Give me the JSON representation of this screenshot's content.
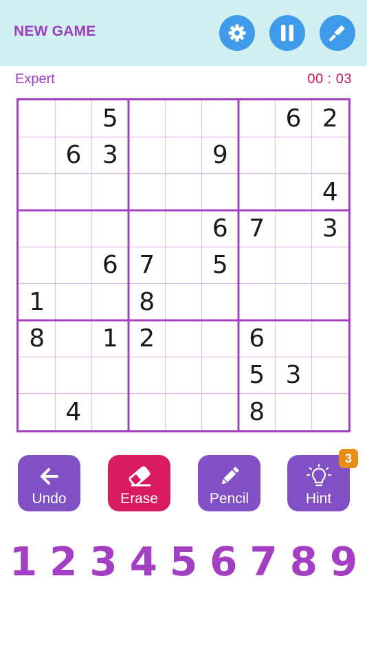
{
  "header": {
    "new_game_label": "NEW GAME",
    "buttons": [
      "gear-icon",
      "pause-icon",
      "paint-brush-icon"
    ]
  },
  "status": {
    "difficulty": "Expert",
    "timer": "00 : 03"
  },
  "board": {
    "rows": [
      [
        "",
        "",
        "5",
        "",
        "",
        "",
        "",
        "6",
        "2"
      ],
      [
        "",
        "6",
        "3",
        "",
        "",
        "9",
        "",
        "",
        ""
      ],
      [
        "",
        "",
        "",
        "",
        "",
        "",
        "",
        "",
        "4"
      ],
      [
        "",
        "",
        "",
        "",
        "",
        "6",
        "7",
        "",
        "3"
      ],
      [
        "",
        "",
        "6",
        "7",
        "",
        "5",
        "",
        "",
        ""
      ],
      [
        "1",
        "",
        "",
        "8",
        "",
        "",
        "",
        "",
        ""
      ],
      [
        "8",
        "",
        "1",
        "2",
        "",
        "",
        "6",
        "",
        ""
      ],
      [
        "",
        "",
        "",
        "",
        "",
        "",
        "5",
        "3",
        ""
      ],
      [
        "",
        "4",
        "",
        "",
        "",
        "",
        "8",
        "",
        ""
      ]
    ]
  },
  "actions": {
    "undo": "Undo",
    "erase": "Erase",
    "pencil": "Pencil",
    "hint": "Hint",
    "hint_count": "3"
  },
  "numpad": [
    "1",
    "2",
    "3",
    "4",
    "5",
    "6",
    "7",
    "8",
    "9"
  ],
  "colors": {
    "header_bg": "#d2eff2",
    "accent_purple": "#a43fc4",
    "action_purple": "#8150c4",
    "erase_pink": "#d81b60",
    "timer_color": "#c2185b",
    "icon_button_blue": "#3f9bea",
    "badge_orange": "#ea8c17"
  }
}
